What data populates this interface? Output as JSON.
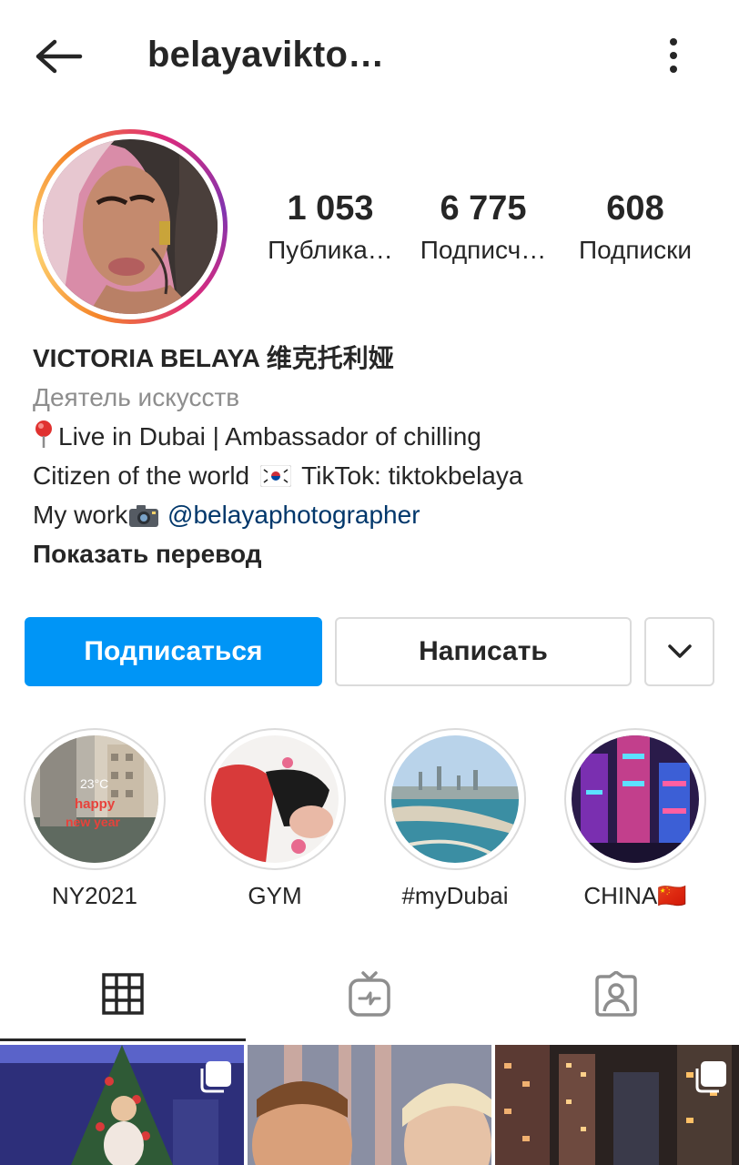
{
  "header": {
    "username": "belayavikto…",
    "back_icon": "arrow-left-icon",
    "more_icon": "more-vertical-icon"
  },
  "stats": [
    {
      "value": "1 053",
      "label": "Публика…"
    },
    {
      "value": "6 775",
      "label": "Подписч…"
    },
    {
      "value": "608",
      "label": "Подписки"
    }
  ],
  "bio": {
    "name": "VICTORIA BELAYA 维克托利娅",
    "category": "Деятель искусств",
    "line1": "Live in Dubai  |  Ambassador of chilling",
    "line2a": "Citizen of the world",
    "line2b": "TikTok: tiktokbelaya",
    "line3a": "My work",
    "line3_link": "@belayaphotographer",
    "translate": "Показать перевод"
  },
  "actions": {
    "follow_label": "Подписаться",
    "message_label": "Написать",
    "dropdown_icon": "chevron-down-icon"
  },
  "highlights": [
    {
      "label": "NY2021",
      "overlay_a": "23°C",
      "overlay_b": "happy",
      "overlay_c": "new year"
    },
    {
      "label": "GYM"
    },
    {
      "label": "#myDubai"
    },
    {
      "label": "CHINA🇨🇳"
    }
  ],
  "tabs": [
    {
      "name": "grid",
      "icon": "grid-icon",
      "active": true
    },
    {
      "name": "igtv",
      "icon": "igtv-icon",
      "active": false
    },
    {
      "name": "tagged",
      "icon": "tagged-person-icon",
      "active": false
    }
  ],
  "colors": {
    "accent": "#0095f6",
    "link": "#00376b",
    "muted": "#8e8e8e",
    "border": "#dbdbdb",
    "text": "#262626"
  }
}
